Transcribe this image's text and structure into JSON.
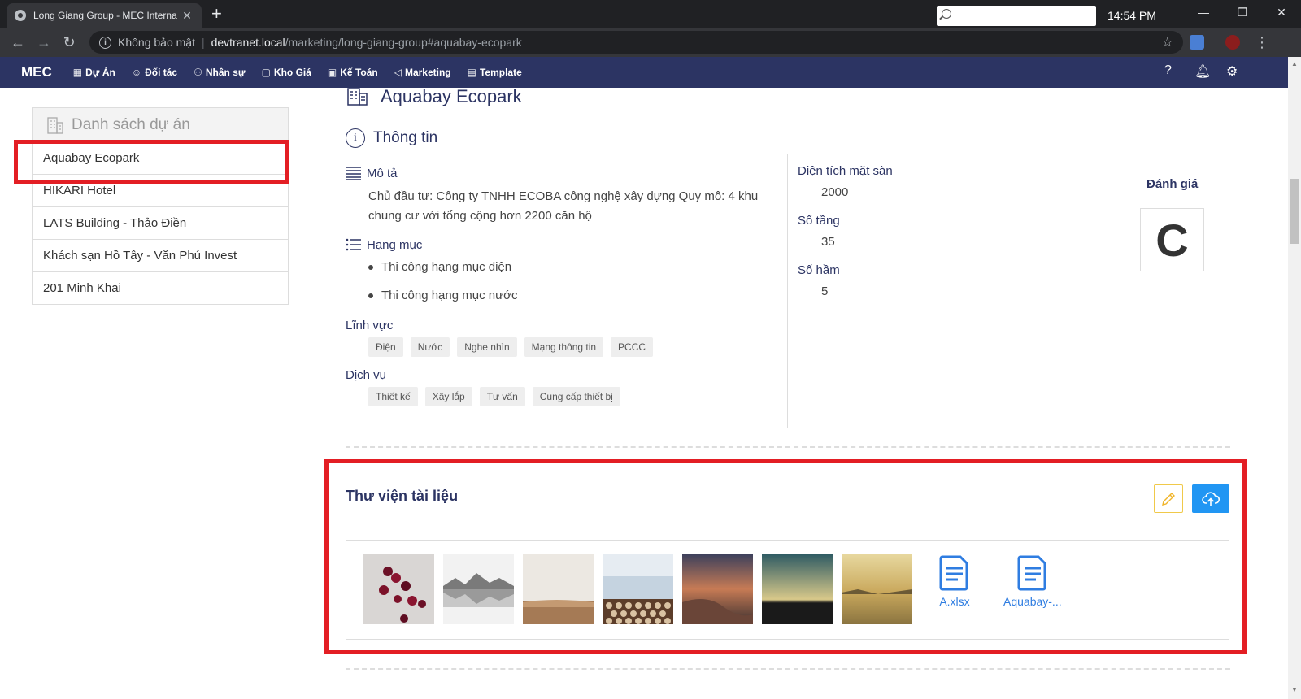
{
  "browser": {
    "tab_title": "Long Giang Group - MEC Interna",
    "security_label": "Không bảo mật",
    "url_host": "devtranet.local",
    "url_path": "/marketing/long-giang-group#aquabay-ecopark"
  },
  "appnav": {
    "brand": "MEC",
    "menu": [
      {
        "label": "Dự Án",
        "icon": "building-icon"
      },
      {
        "label": "Đối tác",
        "icon": "partner-icon"
      },
      {
        "label": "Nhân sự",
        "icon": "people-icon"
      },
      {
        "label": "Kho Giá",
        "icon": "price-icon"
      },
      {
        "label": "Kế Toán",
        "icon": "accounting-icon"
      },
      {
        "label": "Marketing",
        "icon": "megaphone-icon"
      },
      {
        "label": "Template",
        "icon": "document-icon"
      }
    ],
    "time": "14:54 PM",
    "accent": "#2c3463"
  },
  "sidebar": {
    "title": "Danh sách dự án",
    "items": [
      {
        "label": "Aquabay Ecopark"
      },
      {
        "label": "HIKARI Hotel"
      },
      {
        "label": "LATS Building - Thảo Điền"
      },
      {
        "label": "Khách sạn Hồ Tây - Văn Phú Invest"
      },
      {
        "label": "201 Minh Khai"
      }
    ]
  },
  "project": {
    "title": "Aquabay Ecopark",
    "info_title": "Thông tin",
    "desc_label": "Mô tả",
    "desc_line1": "Chủ đầu tư: Công ty TNHH ECOBA công nghệ xây dựng Quy mô: 4 khu",
    "desc_line2": "chung cư với tổng cộng hơn 2200 căn hộ",
    "items_label": "Hạng mục",
    "items": [
      "Thi công hạng mục điện",
      "Thi công hạng mục nước"
    ],
    "fields_label": "Lĩnh vực",
    "fields": [
      "Điện",
      "Nước",
      "Nghe nhìn",
      "Mạng thông tin",
      "PCCC"
    ],
    "services_label": "Dịch vụ",
    "services": [
      "Thiết kế",
      "Xây lắp",
      "Tư vấn",
      "Cung cấp thiết bị"
    ],
    "area_label": "Diện tích mặt sàn",
    "area_value": "2000",
    "floors_label": "Số tầng",
    "floors_value": "35",
    "basements_label": "Số hầm",
    "basements_value": "5",
    "rating_label": "Đánh giá",
    "rating_value": "C"
  },
  "library": {
    "title": "Thư viện tài liệu",
    "files": [
      {
        "name": "A.xlsx"
      },
      {
        "name": "Aquabay-..."
      }
    ]
  }
}
